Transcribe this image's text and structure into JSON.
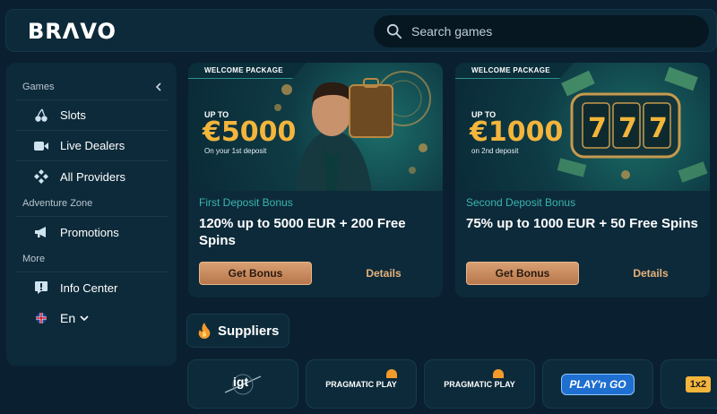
{
  "header": {
    "logo": "BRΛVO",
    "search_placeholder": "Search games"
  },
  "sidebar": {
    "sections": [
      {
        "title": "Games",
        "items": [
          "Slots",
          "Live Dealers",
          "All Providers"
        ]
      },
      {
        "title": "Adventure Zone",
        "items": [
          "Promotions"
        ]
      },
      {
        "title": "More",
        "items": [
          "Info Center"
        ]
      }
    ],
    "collapse_icon": "chevron-left-icon",
    "language": "En"
  },
  "cards": [
    {
      "tag": "WELCOME PACKAGE",
      "upto": "UP TO",
      "amount": "€5000",
      "sub": "On your 1st deposit",
      "label": "First Deposit Bonus",
      "title": "120% up to 5000 EUR + 200 Free Spins",
      "button": "Get Bonus",
      "details": "Details"
    },
    {
      "tag": "WELCOME PACKAGE",
      "upto": "UP TO",
      "amount": "€1000",
      "sub": "on 2nd deposit",
      "label": "Second Deposit Bonus",
      "title": "75% up to 1000 EUR + 50 Free Spins",
      "button": "Get Bonus",
      "details": "Details"
    }
  ],
  "suppliers": {
    "title": "Suppliers",
    "providers": [
      "igt",
      "PRAGMATIC PLAY",
      "PRAGMATIC PLAY",
      "PLAY'n GO",
      "1x2"
    ]
  },
  "colors": {
    "background": "#0a2030",
    "panel": "#0d2a3a",
    "accent_teal": "#37b6b0",
    "accent_gold": "#f3b53b",
    "button_copper": "#c98a5c"
  }
}
